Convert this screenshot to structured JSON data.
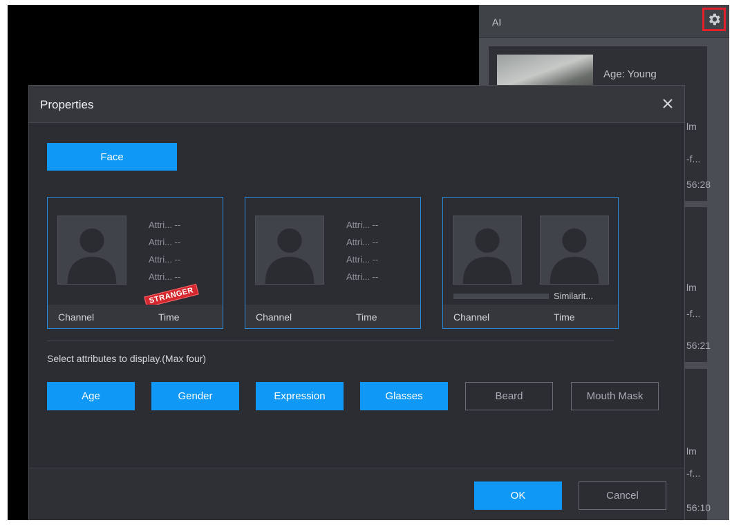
{
  "ai_panel": {
    "title": "AI",
    "cards": [
      {
        "age": "Age: Young",
        "peek1": "lm",
        "peek2": "-f...",
        "time_tail": "56:28"
      },
      {
        "peek1": "lm",
        "peek2": "-f...",
        "time_tail": "56:21"
      },
      {
        "peek1": "lm",
        "peek2": "-f...",
        "time_tail": "56:10"
      }
    ]
  },
  "dialog": {
    "title": "Properties",
    "tab_face": "Face",
    "attr_placeholder": "Attri... --",
    "stranger_label": "STRANGER",
    "similarity_label": "Similarit...",
    "footer": {
      "channel": "Channel",
      "time": "Time"
    },
    "hint": "Select attributes to display.(Max four)",
    "attributes": [
      {
        "label": "Age",
        "selected": true
      },
      {
        "label": "Gender",
        "selected": true
      },
      {
        "label": "Expression",
        "selected": true
      },
      {
        "label": "Glasses",
        "selected": true
      },
      {
        "label": "Beard",
        "selected": false
      },
      {
        "label": "Mouth Mask",
        "selected": false
      }
    ],
    "ok": "OK",
    "cancel": "Cancel"
  },
  "colors": {
    "accent": "#0f98f5",
    "highlight_border": "#e0212b",
    "stranger": "#d6282f"
  }
}
